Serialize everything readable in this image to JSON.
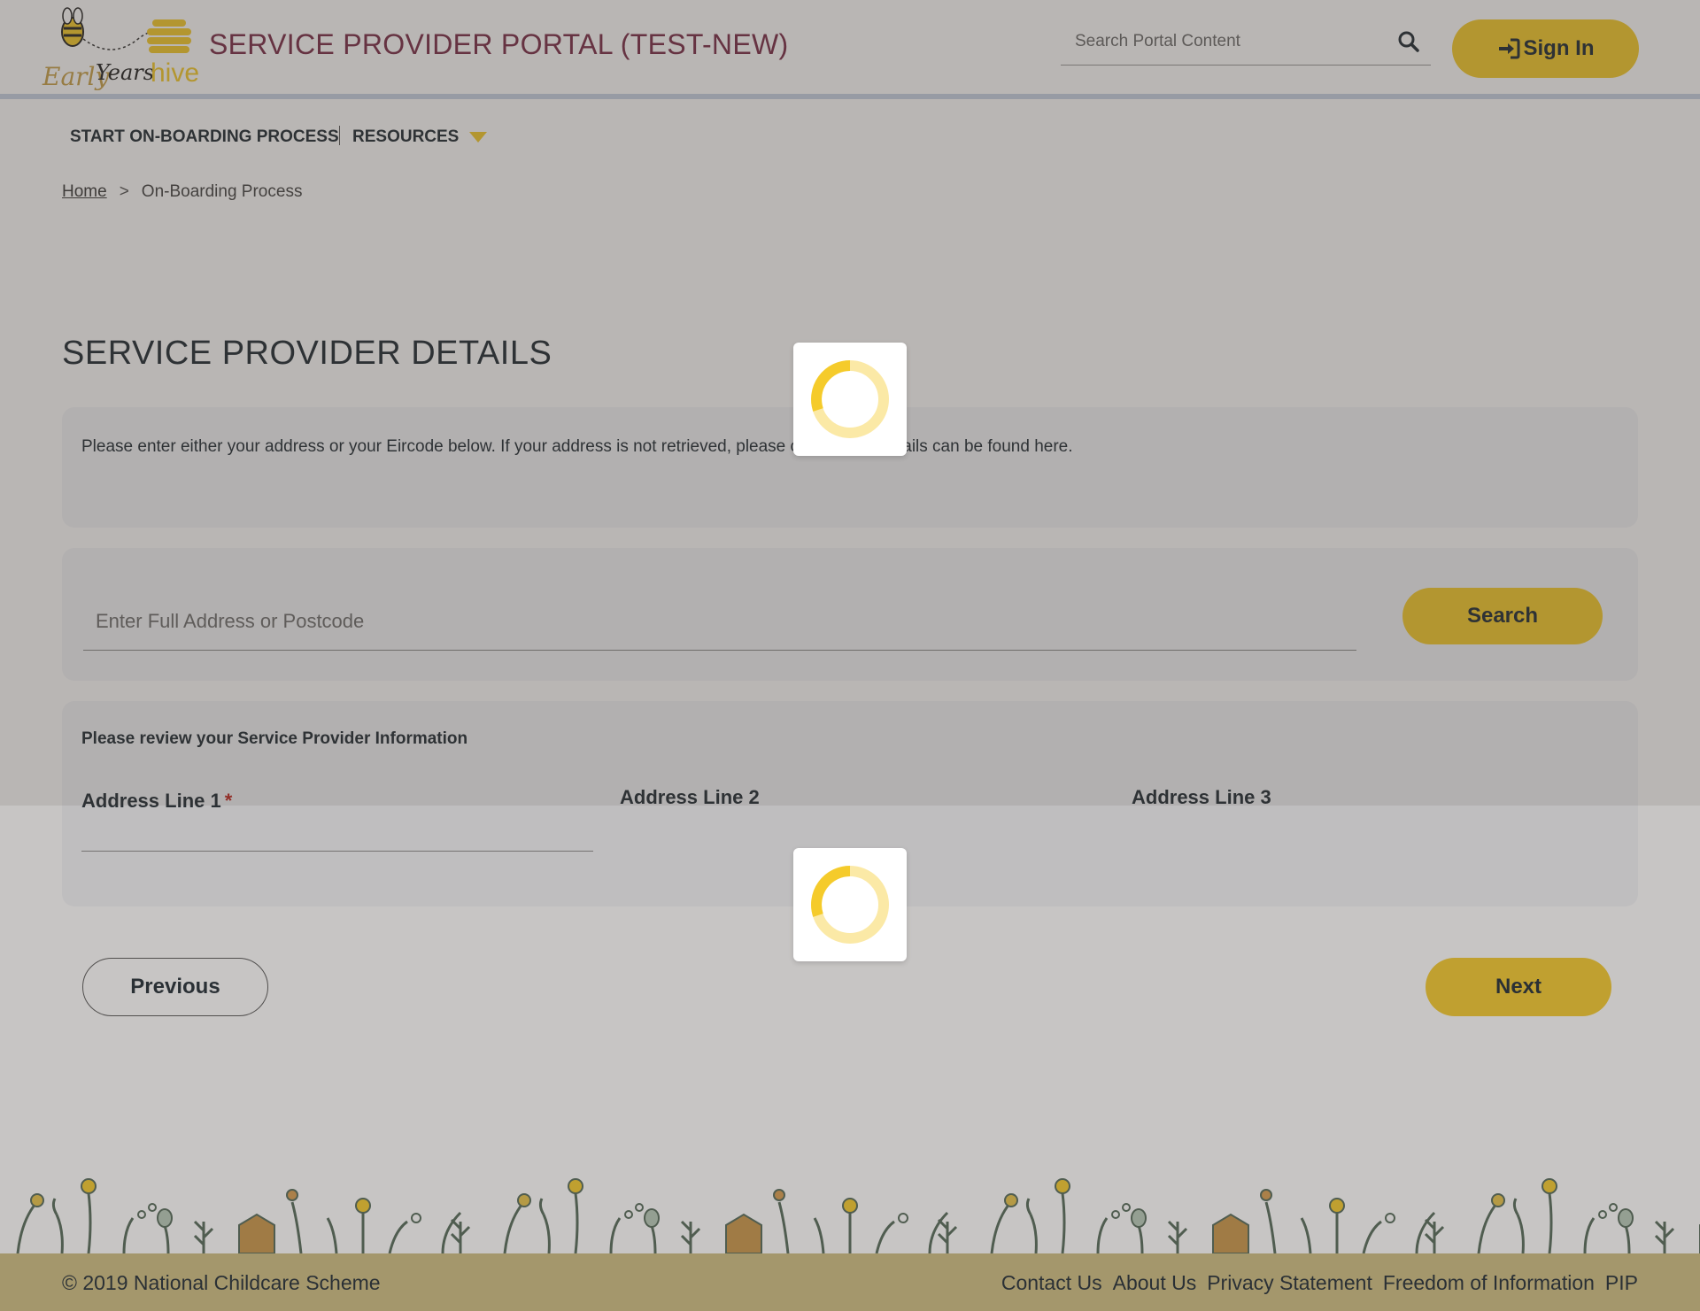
{
  "header": {
    "logo_text": "Early Years hive",
    "portal_title": "SERVICE PROVIDER PORTAL (TEST-NEW)",
    "search_placeholder": "Search Portal Content",
    "sign_in_label": "Sign In"
  },
  "nav": {
    "items": [
      {
        "label": "START ON-BOARDING PROCESS"
      },
      {
        "label": "RESOURCES",
        "icon": "caret-down-icon"
      }
    ]
  },
  "breadcrumb": {
    "home": "Home",
    "separator": ">",
    "current": "On-Boarding Process"
  },
  "main": {
    "heading": "SERVICE PROVIDER DETAILS",
    "intro_text": "Please enter either your address or your Eircode below. If your address is not retrieved, please contact us. Details can be found here.",
    "address_search_placeholder": "Enter Full Address or Postcode",
    "search_button": "Search",
    "info_heading": "Please review your Service Provider Information",
    "fields": [
      {
        "label": "Address Line 1",
        "required_mark": "*",
        "value": ""
      },
      {
        "label": "Address Line 2"
      },
      {
        "label": "Address Line 3"
      }
    ],
    "previous_button": "Previous",
    "next_button": "Next"
  },
  "footer": {
    "copyright": "© 2019 National Childcare Scheme",
    "links": [
      "Contact Us",
      "About Us",
      "Privacy Statement",
      "Freedom of Information",
      "PIP"
    ]
  },
  "colors": {
    "accent_yellow": "#f5cb2b",
    "title_maroon": "#7a2c48",
    "footer_bg": "#cdbd82",
    "panel_bg": "#f4f5f8"
  }
}
